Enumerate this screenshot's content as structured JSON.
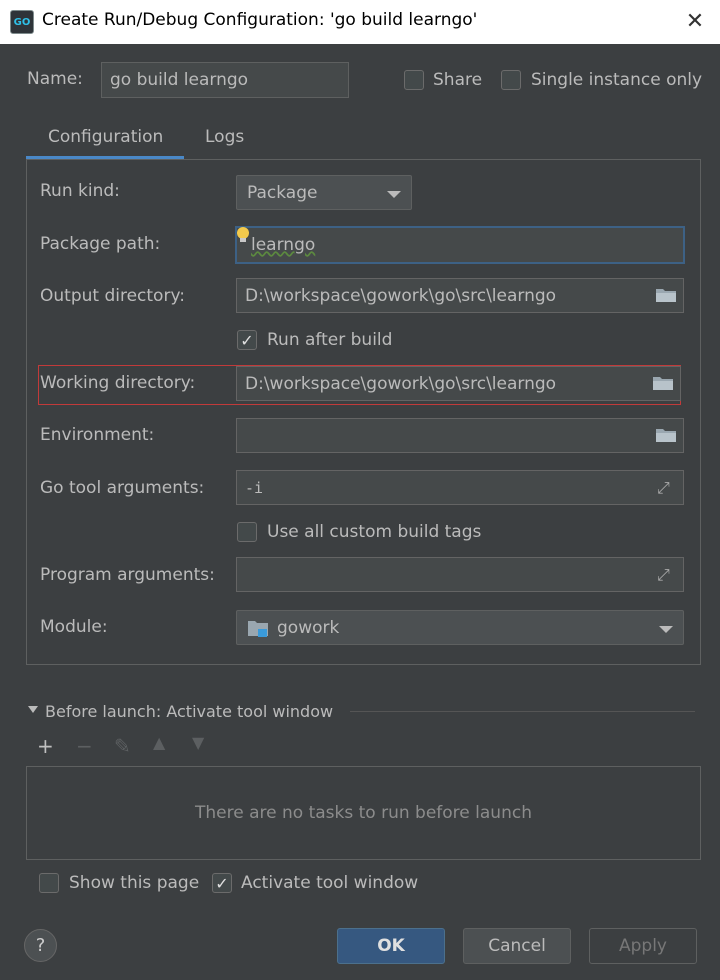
{
  "window": {
    "title": "Create Run/Debug Configuration: 'go build learngo'",
    "app_icon_text": "GO"
  },
  "name_row": {
    "label": "Name:",
    "value": "go build learngo",
    "share_label": "Share",
    "single_instance_label": "Single instance only"
  },
  "tabs": [
    {
      "label": "Configuration",
      "active": true
    },
    {
      "label": "Logs",
      "active": false
    }
  ],
  "config": {
    "run_kind_label": "Run kind:",
    "run_kind_value": "Package",
    "package_path_label": "Package path:",
    "package_path_value": "learngo",
    "output_dir_label": "Output directory:",
    "output_dir_value": "D:\\workspace\\gowork\\go\\src\\learngo",
    "run_after_build_label": "Run after build",
    "run_after_build_checked": true,
    "working_dir_label": "Working directory:",
    "working_dir_value": "D:\\workspace\\gowork\\go\\src\\learngo",
    "environment_label": "Environment:",
    "environment_value": "",
    "go_tool_args_label": "Go tool arguments:",
    "go_tool_args_value": "-i",
    "custom_build_tags_label": "Use all custom build tags",
    "custom_build_tags_checked": false,
    "program_args_label": "Program arguments:",
    "program_args_value": "",
    "module_label": "Module:",
    "module_value": "gowork"
  },
  "before_launch": {
    "header": "Before launch: Activate tool window",
    "empty_text": "There are no tasks to run before launch"
  },
  "footer": {
    "show_page_label": "Show this page",
    "show_page_checked": false,
    "activate_tool_label": "Activate tool window",
    "activate_tool_checked": true,
    "ok_label": "OK",
    "cancel_label": "Cancel",
    "apply_label": "Apply",
    "help_label": "?"
  },
  "colors": {
    "background": "#3c3f41",
    "accent": "#4a88c7",
    "highlight_box": "#c23a3a"
  }
}
